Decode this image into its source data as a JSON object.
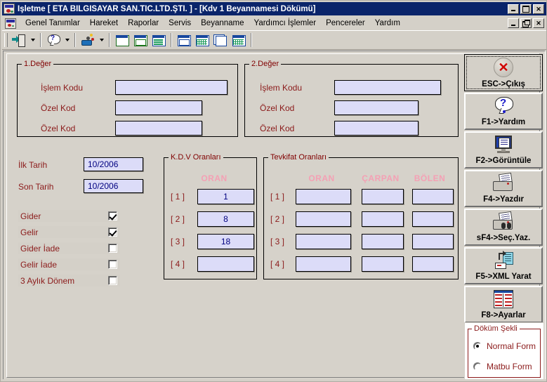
{
  "window": {
    "title": "İşletme [ ETA BİLGİSAYAR SAN.TİC.LTD.ŞTİ. ]  - [Kdv 1 Beyannamesi Dökümü]",
    "app_icon": "application-icon",
    "buttons": {
      "minimize": "_",
      "maximize": "□",
      "close": "X"
    },
    "mdi_buttons": {
      "minimize": "_",
      "restore": "❐",
      "close": "X"
    }
  },
  "menu": {
    "icon": "document-icon",
    "items": [
      {
        "label": "Genel Tanımlar"
      },
      {
        "label": "Hareket"
      },
      {
        "label": "Raporlar"
      },
      {
        "label": "Servis"
      },
      {
        "label": "Beyanname"
      },
      {
        "label": "Yardımcı İşlemler"
      },
      {
        "label": "Pencereler"
      },
      {
        "label": "Yardım"
      }
    ]
  },
  "toolbar": {
    "buttons": [
      {
        "name": "exit-icon"
      },
      {
        "name": "dropdown-arrow"
      },
      {
        "name": "help-icon"
      },
      {
        "name": "dropdown-arrow"
      },
      {
        "name": "user-icon"
      },
      {
        "name": "dropdown-arrow"
      },
      {
        "name": "new-window-icon"
      },
      {
        "name": "list-window-icon"
      },
      {
        "name": "table-window-icon"
      },
      {
        "name": "form-window-icon"
      },
      {
        "name": "grid-window-icon"
      },
      {
        "name": "cascade-window-icon"
      },
      {
        "name": "tile-window-icon"
      }
    ]
  },
  "group1": {
    "title": "1.Değer",
    "fields": [
      {
        "label": "İşlem Kodu",
        "value": "",
        "button_icon": "list-lookup-icon"
      },
      {
        "label": "Özel Kod",
        "value": "",
        "button_icon": "tree-lookup-icon"
      },
      {
        "label": "Özel Kod",
        "value": "",
        "button_icon": "tree-lookup-icon"
      }
    ]
  },
  "group2": {
    "title": "2.Değer",
    "fields": [
      {
        "label": "İşlem Kodu",
        "value": "",
        "button_icon": "list-lookup-icon"
      },
      {
        "label": "Özel Kod",
        "value": "",
        "button_icon": "tree-lookup-icon"
      },
      {
        "label": "Özel Kod",
        "value": "",
        "button_icon": "tree-lookup-icon"
      }
    ]
  },
  "dates": {
    "first": {
      "label": "İlk Tarih",
      "value": "10/2006",
      "button_icon": "calendar-icon"
    },
    "last": {
      "label": "Son Tarih",
      "value": "10/2006",
      "button_icon": "calendar-icon"
    }
  },
  "checkboxes": [
    {
      "label": "Gider",
      "checked": true
    },
    {
      "label": "Gelir",
      "checked": true
    },
    {
      "label": "Gider İade",
      "checked": false
    },
    {
      "label": "Gelir İade",
      "checked": false
    },
    {
      "label": "3 Aylık Dönem",
      "checked": false
    }
  ],
  "kdv": {
    "title": "K.D.V Oranları",
    "columns": [
      "ORAN"
    ],
    "rows": [
      {
        "index": "[ 1 ]",
        "oran": "1"
      },
      {
        "index": "[ 2 ]",
        "oran": "8"
      },
      {
        "index": "[ 3 ]",
        "oran": "18"
      },
      {
        "index": "[ 4 ]",
        "oran": ""
      }
    ]
  },
  "tevkifat": {
    "title": "Tevkifat Oranları",
    "columns": [
      "ORAN",
      "ÇARPAN",
      "BÖLEN"
    ],
    "rows": [
      {
        "index": "[ 1 ]",
        "oran": "",
        "carpan": "",
        "bolen": ""
      },
      {
        "index": "[ 2 ]",
        "oran": "",
        "carpan": "",
        "bolen": ""
      },
      {
        "index": "[ 3 ]",
        "oran": "",
        "carpan": "",
        "bolen": ""
      },
      {
        "index": "[ 4 ]",
        "oran": "",
        "carpan": "",
        "bolen": ""
      }
    ]
  },
  "sidebar": {
    "buttons": [
      {
        "label": "ESC->Çıkış",
        "icon": "close-circle-icon",
        "focused": true
      },
      {
        "label": "F1->Yardım",
        "icon": "question-balloon-icon",
        "focused": false
      },
      {
        "label": "F2->Görüntüle",
        "icon": "monitor-preview-icon",
        "focused": false
      },
      {
        "label": "F4->Yazdır",
        "icon": "printer-icon",
        "focused": false
      },
      {
        "label": "sF4->Seç.Yaz.",
        "icon": "printer-select-icon",
        "focused": false
      },
      {
        "label": "F5->XML Yarat",
        "icon": "xml-export-icon",
        "focused": false
      },
      {
        "label": "F8->Ayarlar",
        "icon": "settings-list-icon",
        "focused": false
      }
    ]
  },
  "print_form": {
    "title": "Döküm Şekli",
    "options": [
      {
        "label": "Normal Form",
        "selected": true
      },
      {
        "label": "Matbu Form",
        "selected": false
      }
    ]
  },
  "colors": {
    "titlebar": "#0a246a",
    "face": "#d4d0c8",
    "form_face": "#d6d2ca",
    "field_bg": "#dcdcf8",
    "label_red": "#8b1a1a",
    "header_pink": "#f4a0b4",
    "value_blue": "#000080"
  }
}
